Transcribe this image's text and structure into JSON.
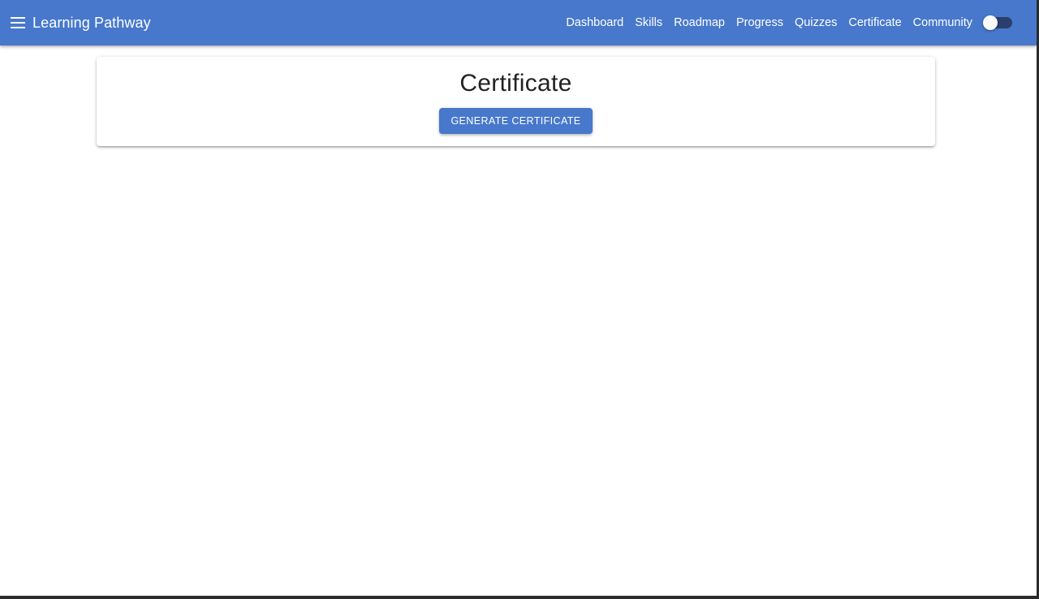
{
  "app": {
    "title": "Learning Pathway",
    "brand_color": "#4778cc",
    "menu_icon": "menu-icon"
  },
  "nav": {
    "items": [
      {
        "label": "Dashboard"
      },
      {
        "label": "Skills"
      },
      {
        "label": "Roadmap"
      },
      {
        "label": "Progress"
      },
      {
        "label": "Quizzes"
      },
      {
        "label": "Certificate"
      },
      {
        "label": "Community"
      }
    ],
    "theme_toggle": {
      "state": "off"
    }
  },
  "main": {
    "card": {
      "title": "Certificate",
      "button_label": "GENERATE CERTIFICATE"
    }
  }
}
